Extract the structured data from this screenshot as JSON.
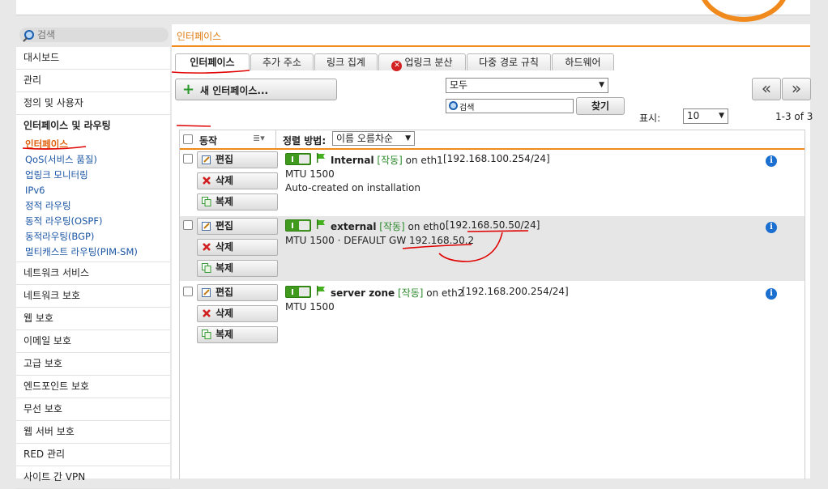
{
  "search": {
    "placeholder": "검색"
  },
  "breadcrumb": "인터페이스",
  "sidebar": {
    "top_items": [
      "대시보드",
      "관리",
      "정의 및 사용자"
    ],
    "group_label": "인터페이스 및 라우팅",
    "sub_items": [
      "인터페이스",
      "QoS(서비스 품질)",
      "업링크 모니터링",
      "IPv6",
      "정적 라우팅",
      "동적 라우팅(OSPF)",
      "동적라우팅(BGP)",
      "멀티캐스트 라우팅(PIM-SM)"
    ],
    "bottom_items": [
      "네트워크 서비스",
      "네트워크 보호",
      "웹 보호",
      "이메일 보호",
      "고급 보호",
      "엔드포인트 보호",
      "무선 보호",
      "웹 서버 보호",
      "RED 관리",
      "사이트 간 VPN"
    ]
  },
  "tabs": [
    "인터페이스",
    "추가 주소",
    "링크 집계",
    "업링크 분산",
    "다중 경로 규칙",
    "하드웨어"
  ],
  "toolbar": {
    "new_button": "새 인터페이스...",
    "filter_value": "모두",
    "search_value": "검색",
    "find_button": "찾기",
    "display_label": "표시:",
    "page_size": "10",
    "range": "1-3 of 3",
    "prev": "«",
    "next": "»"
  },
  "grid": {
    "action_header": "동작",
    "sort_label": "정렬 방법:",
    "sort_value": "이름 오름차순",
    "actions": {
      "edit": "편집",
      "delete": "삭제",
      "clone": "복제"
    },
    "rows": [
      {
        "name": "Internal",
        "status": "[작동]",
        "on": "on eth1",
        "address": "[192.168.100.254/24]",
        "line2": "MTU 1500",
        "line3": "Auto-created on installation"
      },
      {
        "name": "external",
        "status": "[작동]",
        "on": "on eth0",
        "address": "[192.168.50.50/24]",
        "line2": "MTU 1500 · DEFAULT GW 192.168.50.2",
        "line3": ""
      },
      {
        "name": "server zone",
        "status": "[작동]",
        "on": "on eth2",
        "address": "[192.168.200.254/24]",
        "line2": "MTU 1500",
        "line3": ""
      }
    ]
  },
  "colors": {
    "accent": "#f08a1c",
    "link": "#1a55a4",
    "active_nav": "#e0600e",
    "annotation": "#e00000"
  }
}
